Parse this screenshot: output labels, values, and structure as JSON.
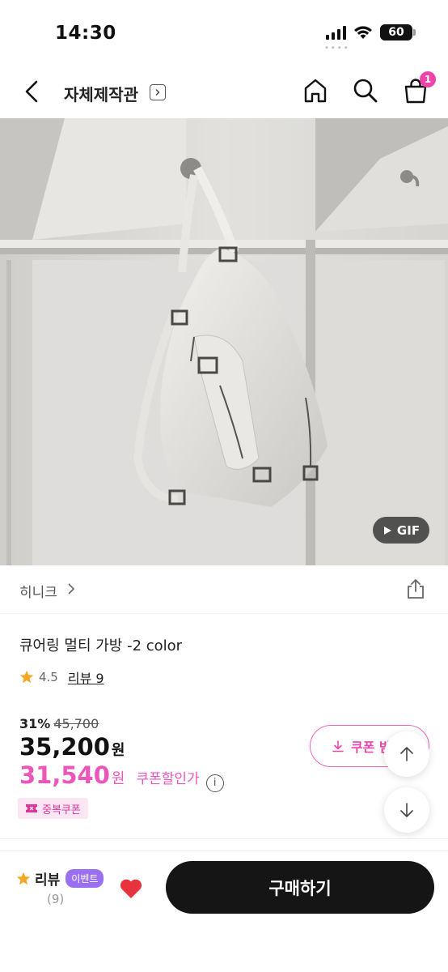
{
  "status_bar": {
    "time": "14:30",
    "battery": "60",
    "icons": [
      "cellular-signal-icon",
      "wifi-icon",
      "battery-icon"
    ]
  },
  "nav": {
    "title": "자체제작관",
    "cart_badge": "1",
    "icons": [
      "back-arrow-icon",
      "chevron-right-icon",
      "home-icon",
      "search-icon",
      "cart-icon"
    ]
  },
  "product_image": {
    "alt_subject": "white leather multi bag hanging on hook",
    "gif_label": "GIF"
  },
  "brand": {
    "name": "히니크"
  },
  "product": {
    "name": "큐어링 멀티 가방 -2 color",
    "rating": "4.5",
    "review_link": "리뷰 9"
  },
  "price": {
    "discount_rate": "31%",
    "original": "45,700",
    "sale": "35,200",
    "sale_unit": "원",
    "coupon_price": "31,540",
    "coupon_unit": "원",
    "coupon_label": "쿠폰할인가",
    "info_symbol": "i"
  },
  "coupon_button": {
    "label": "쿠폰 받기"
  },
  "stack_coupon": {
    "label": "중복쿠폰"
  },
  "bottom_bar": {
    "review_label": "리뷰",
    "event_badge": "이벤트",
    "review_count": "(9)",
    "buy_label": "구매하기"
  },
  "colors": {
    "accent_pink": "#ee44aa",
    "event_purple": "#9a6ff0",
    "buy_button": "#151515",
    "star": "#f5a623",
    "heart": "#e8323c"
  }
}
